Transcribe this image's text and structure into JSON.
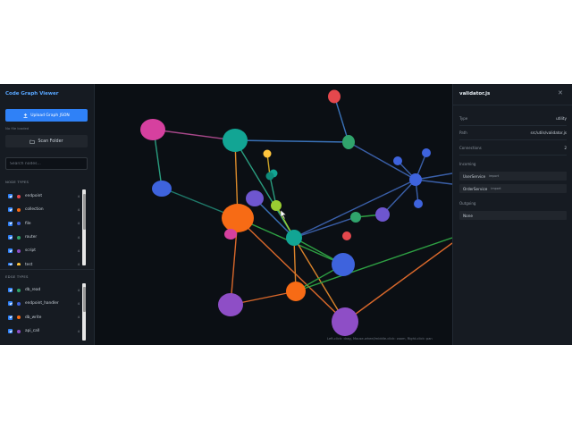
{
  "sidebar": {
    "title": "Code Graph Viewer",
    "upload_label": "Upload Graph JSON",
    "file_status": "No file loaded",
    "scan_label": "Scan Folder",
    "search_placeholder": "Search nodes...",
    "node_types_heading": "NODE TYPES",
    "node_types": [
      {
        "label": "endpoint",
        "color": "#e5484d",
        "count": "4"
      },
      {
        "label": "collection",
        "color": "#f76b15",
        "count": "4"
      },
      {
        "label": "file",
        "color": "#3e63dd",
        "count": "4"
      },
      {
        "label": "router",
        "color": "#30a46c",
        "count": "4"
      },
      {
        "label": "script",
        "color": "#8e4ec6",
        "count": "4"
      },
      {
        "label": "test",
        "color": "#ffc53d",
        "count": "4"
      }
    ],
    "edge_types_heading": "EDGE TYPES",
    "edge_types": [
      {
        "label": "db_read",
        "color": "#30a46c",
        "count": "4"
      },
      {
        "label": "endpoint_handler",
        "color": "#3e63dd",
        "count": "4"
      },
      {
        "label": "db_write",
        "color": "#f76b15",
        "count": "4"
      },
      {
        "label": "api_call",
        "color": "#8e4ec6",
        "count": "4"
      }
    ]
  },
  "graph": {
    "hint": "Left-click: drag, Mouse-wheel/middle-click: zoom, Right-click: pan"
  },
  "panel": {
    "title": "validator.js",
    "type_label": "Type",
    "type_value": "utility",
    "path_label": "Path",
    "path_value": "src/utils/validator.js",
    "connections_label": "Connections",
    "connections_value": "2",
    "incoming_label": "Incoming",
    "incoming": [
      {
        "name": "UserService",
        "kind": "import"
      },
      {
        "name": "OrderService",
        "kind": "import"
      }
    ],
    "outgoing_label": "Outgoing",
    "outgoing_empty": "None"
  },
  "colors": {
    "accent": "#2f81f7",
    "background": "#0b0f14",
    "panel": "#161b22"
  }
}
